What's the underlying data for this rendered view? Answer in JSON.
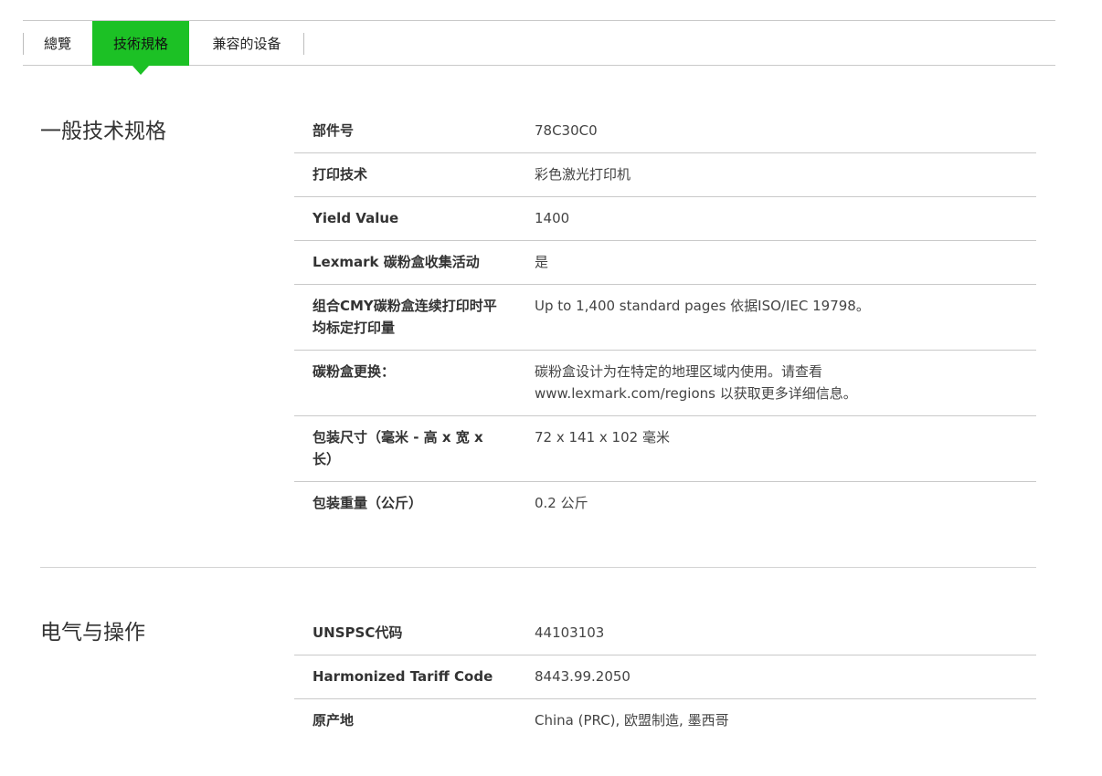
{
  "tabs": [
    {
      "label": "總覽",
      "active": false
    },
    {
      "label": "技術規格",
      "active": true
    },
    {
      "label": "兼容的设备",
      "active": false
    }
  ],
  "accent_color": "#1cc125",
  "general": {
    "title": "一般技术规格",
    "rows": [
      {
        "label": "部件号",
        "value": "78C30C0"
      },
      {
        "label": "打印技术",
        "value": "彩色激光打印机"
      },
      {
        "label": "Yield Value",
        "value": "1400"
      },
      {
        "label": "Lexmark 碳粉盒收集活动",
        "value": "是"
      },
      {
        "label": "组合CMY碳粉盒连续打印时平均标定打印量",
        "value": "Up to 1,400 standard pages 依据ISO/IEC 19798。"
      },
      {
        "label": "碳粉盒更换：",
        "value": "碳粉盒设计为在特定的地理区域内使用。请查看 www.lexmark.com/regions 以获取更多详细信息。"
      },
      {
        "label": "包装尺寸（毫米 - 高 x 宽 x 长）",
        "value": "72 x 141 x 102 毫米"
      },
      {
        "label": "包装重量（公斤）",
        "value": "0.2 公斤"
      }
    ]
  },
  "electrical": {
    "title": "电气与操作",
    "rows": [
      {
        "label": "UNSPSC代码",
        "value": "44103103"
      },
      {
        "label": "Harmonized Tariff Code",
        "value": "8443.99.2050"
      },
      {
        "label": "原产地",
        "value": "China (PRC), 欧盟制造, 墨西哥"
      }
    ]
  }
}
